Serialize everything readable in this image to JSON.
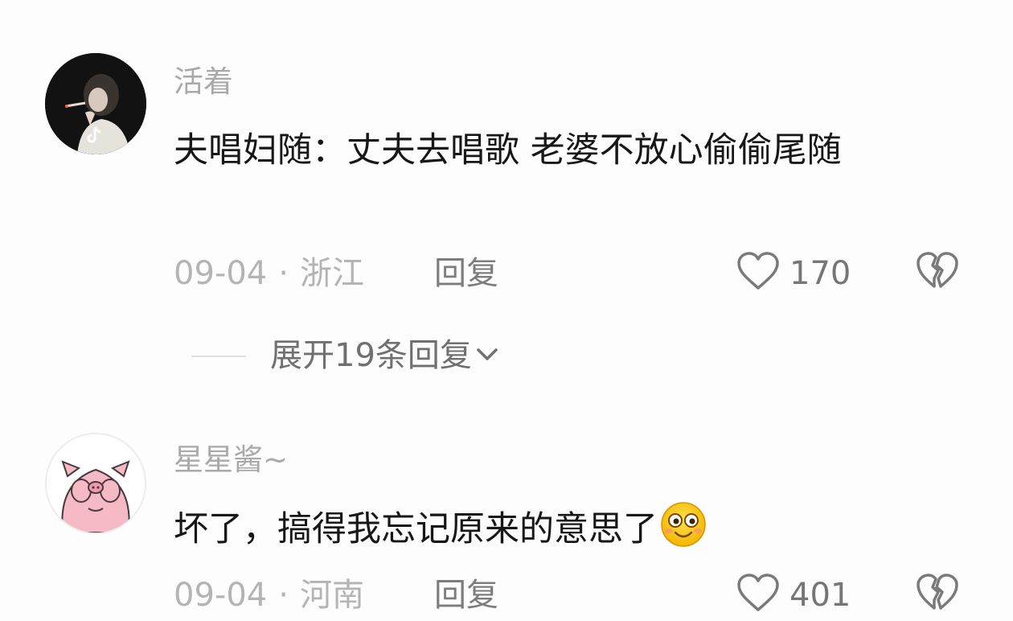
{
  "comments": [
    {
      "username": "活着",
      "text": "夫唱妇随：丈夫去唱歌 老婆不放心偷偷尾随",
      "date": "09-04",
      "separator": "·",
      "location": "浙江",
      "reply_label": "回复",
      "likes": "170",
      "avatar": "avatar-dark-photo",
      "like_icon": "heart-outline-icon",
      "dislike_icon": "broken-heart-icon"
    },
    {
      "username": "星星酱~",
      "text": "坏了，搞得我忘记原来的意思了",
      "emoji": "smiling-face-emoji",
      "date": "09-04",
      "separator": "·",
      "location": "河南",
      "reply_label": "回复",
      "likes": "401",
      "avatar": "pink-pig-avatar",
      "like_icon": "heart-outline-icon",
      "dislike_icon": "broken-heart-icon"
    }
  ],
  "expand_replies": {
    "label": "展开19条回复",
    "icon": "chevron-down-icon"
  },
  "colors": {
    "background": "#fdfdfd",
    "username": "#a9a9a9",
    "text": "#171717",
    "meta": "#b4b4b4",
    "action": "#7d7d7d",
    "pig_pink": "#f6b9c6"
  }
}
